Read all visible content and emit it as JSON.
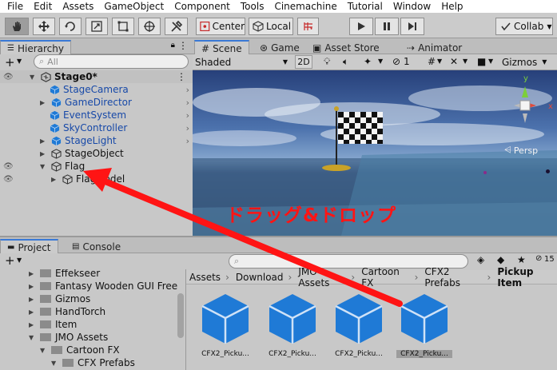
{
  "menu": [
    "File",
    "Edit",
    "Assets",
    "GameObject",
    "Component",
    "Tools",
    "Cinemachine",
    "Tutorial",
    "Window",
    "Help"
  ],
  "toolbar": {
    "pivot_label": "Center",
    "space_label": "Local",
    "collab_label": "Collab"
  },
  "hierarchy": {
    "tab_label": "Hierarchy",
    "search_placeholder": "All",
    "scene_name": "Stage0*",
    "items": [
      {
        "label": "StageCamera"
      },
      {
        "label": "GameDirector"
      },
      {
        "label": "EventSystem"
      },
      {
        "label": "SkyController"
      },
      {
        "label": "StageLight"
      },
      {
        "label": "StageObject"
      },
      {
        "label": "Flag"
      },
      {
        "label": "FlagModel"
      }
    ]
  },
  "scene": {
    "tabs": [
      "Scene",
      "Game",
      "Asset Store",
      "Animator"
    ],
    "shading_mode": "Shaded",
    "mode_2d": "2D",
    "gizmos_label": "Gizmos",
    "persp_label": "Persp",
    "hidden_count": "1",
    "axis_y": "y",
    "axis_x": "x"
  },
  "project": {
    "tab_label": "Project",
    "console_label": "Console",
    "hidden_count": "15",
    "tree": [
      {
        "label": "Effekseer"
      },
      {
        "label": "Fantasy Wooden GUI  Free"
      },
      {
        "label": "Gizmos"
      },
      {
        "label": "HandTorch"
      },
      {
        "label": "Item"
      },
      {
        "label": "JMO Assets"
      },
      {
        "label": "Cartoon FX"
      },
      {
        "label": "CFX Prefabs"
      }
    ],
    "breadcrumb": [
      "Assets",
      "Download",
      "JMO Assets",
      "Cartoon FX",
      "CFX2 Prefabs",
      "Pickup Item"
    ],
    "assets": [
      {
        "label": "CFX2_Picku..."
      },
      {
        "label": "CFX2_Picku..."
      },
      {
        "label": "CFX2_Picku..."
      },
      {
        "label": "CFX2_Picku..."
      }
    ]
  },
  "annotation": {
    "text": "ドラッグ&ドロップ",
    "color": "#ff1414"
  },
  "colors": {
    "accent_blue": "#1749a8",
    "active_tab": "#3a79d6",
    "cube_blue": "#1f7ad6"
  }
}
